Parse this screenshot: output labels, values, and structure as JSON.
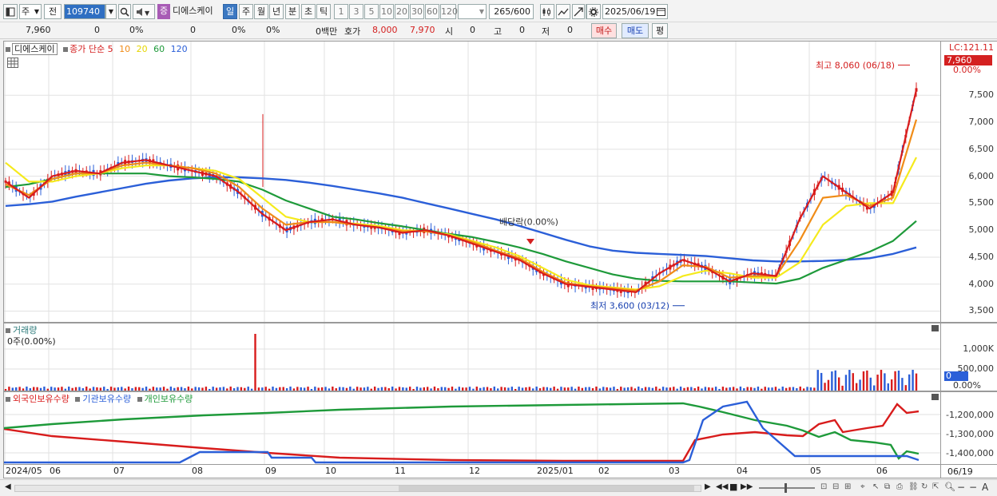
{
  "toolbar": {
    "market_type": "주",
    "prev_label": "전",
    "stock_code": "109740",
    "jeung_badge": "증",
    "stock_name": "디에스케이",
    "periods": [
      "일",
      "주",
      "월",
      "년",
      "분",
      "초",
      "틱"
    ],
    "active_period": "일",
    "intervals": [
      "1",
      "3",
      "5",
      "10",
      "20",
      "30",
      "60",
      "120"
    ],
    "count_display": "265/600",
    "date_value": "2025/06/19"
  },
  "quote_bar": {
    "price": "7,960",
    "change": "0",
    "change_pct": "0%",
    "volume": "0",
    "volume_pct": "0%",
    "other_pct": "0%",
    "amount": "0백만",
    "hoga_label": "호가",
    "ask": "8,000",
    "bid": "7,970",
    "open_label": "시",
    "open": "0",
    "high_label": "고",
    "high": "0",
    "low_label": "저",
    "low": "0",
    "buy_label": "매수",
    "sell_label": "매도",
    "avg_label": "평"
  },
  "price_legend": {
    "name": "디에스케이",
    "type": "종가 단순",
    "ma": [
      {
        "label": "5",
        "color": "#d81c1c"
      },
      {
        "label": "10",
        "color": "#f08c18"
      },
      {
        "label": "20",
        "color": "#f0e418"
      },
      {
        "label": "60",
        "color": "#1e9a3a"
      },
      {
        "label": "120",
        "color": "#2b5fd8"
      }
    ]
  },
  "price_axis": {
    "lc_label": "LC:121.11",
    "current_price": "7,960",
    "pct_label": "0.00%",
    "ticks": [
      "7,500",
      "7,000",
      "6,500",
      "6,000",
      "5,500",
      "5,000",
      "4,500",
      "4,000",
      "3,500"
    ]
  },
  "annotations": {
    "high_label": "최고 8,060 (06/18)",
    "low_label": "최저 3,600 (03/12)",
    "dividend_label": "배당락(0.00%)"
  },
  "volume_panel": {
    "title": "거래량",
    "info": "0주(0.00%)",
    "ticks": [
      "1,000K",
      "500,000"
    ],
    "current": "0",
    "pct": "0.00%"
  },
  "holdings_panel": {
    "legend": [
      {
        "label": "외국인보유수량",
        "color": "#d81c1c"
      },
      {
        "label": "기관보유수량",
        "color": "#2b5fd8"
      },
      {
        "label": "개인보유수량",
        "color": "#1e9a3a"
      }
    ],
    "ticks": [
      "-1,200,000",
      "-1,300,000",
      "-1,400,000"
    ]
  },
  "x_axis": {
    "labels": [
      "2024/05",
      "06",
      "07",
      "08",
      "09",
      "10",
      "11",
      "12",
      "2025/01",
      "02",
      "03",
      "04",
      "05",
      "06"
    ],
    "right_label": "06/19"
  },
  "chart_data": {
    "type": "line",
    "title": "디에스케이",
    "ylim": [
      3300,
      8200
    ],
    "series": [
      {
        "name": "5",
        "values": [
          5900,
          5600,
          6000,
          6100,
          6050,
          6250,
          6300,
          6200,
          6100,
          6000,
          5700,
          5300,
          5000,
          5150,
          5200,
          5100,
          5050,
          4950,
          5000,
          4900,
          4750,
          4600,
          4450,
          4200,
          4000,
          3950,
          3900,
          3850,
          4200,
          4450,
          4300,
          4050,
          4200,
          4150,
          5200,
          6000,
          5700,
          5400,
          5700,
          7600
        ]
      },
      {
        "name": "10",
        "values": [
          5850,
          5650,
          5950,
          6050,
          6050,
          6200,
          6250,
          6200,
          6150,
          6050,
          5800,
          5400,
          5100,
          5150,
          5150,
          5100,
          5050,
          4980,
          4980,
          4900,
          4780,
          4620,
          4480,
          4230,
          4020,
          3960,
          3920,
          3880,
          4050,
          4350,
          4320,
          4120,
          4150,
          4150,
          4800,
          5600,
          5650,
          5450,
          5600,
          7050
        ]
      },
      {
        "name": "20",
        "values": [
          6250,
          5900,
          5900,
          6000,
          6050,
          6150,
          6200,
          6200,
          6150,
          6100,
          5950,
          5600,
          5250,
          5150,
          5150,
          5120,
          5080,
          5000,
          4980,
          4920,
          4800,
          4680,
          4520,
          4300,
          4080,
          3980,
          3940,
          3900,
          3960,
          4150,
          4250,
          4200,
          4120,
          4120,
          4400,
          5100,
          5450,
          5500,
          5500,
          6350
        ]
      },
      {
        "name": "60",
        "values": [
          5800,
          5850,
          5950,
          6050,
          6050,
          6050,
          6050,
          6000,
          5980,
          5950,
          5900,
          5750,
          5550,
          5400,
          5250,
          5200,
          5130,
          5070,
          5000,
          4930,
          4870,
          4780,
          4680,
          4560,
          4420,
          4300,
          4180,
          4100,
          4060,
          4050,
          4050,
          4050,
          4030,
          4010,
          4100,
          4300,
          4450,
          4600,
          4800,
          5170
        ]
      },
      {
        "name": "120",
        "values": [
          5450,
          5480,
          5530,
          5620,
          5700,
          5780,
          5860,
          5920,
          5960,
          5980,
          5980,
          5960,
          5930,
          5880,
          5820,
          5750,
          5680,
          5600,
          5500,
          5400,
          5300,
          5200,
          5080,
          4950,
          4820,
          4700,
          4620,
          4580,
          4560,
          4540,
          4520,
          4480,
          4440,
          4420,
          4420,
          4430,
          4450,
          4480,
          4560,
          4680
        ]
      }
    ],
    "x_labels": [
      "2024/05",
      "06",
      "07",
      "08",
      "09",
      "10",
      "11",
      "12",
      "2025/01",
      "02",
      "03",
      "04",
      "05",
      "06"
    ],
    "high": {
      "value": 8060,
      "date": "06/18"
    },
    "low": {
      "value": 3600,
      "date": "03/12"
    }
  }
}
